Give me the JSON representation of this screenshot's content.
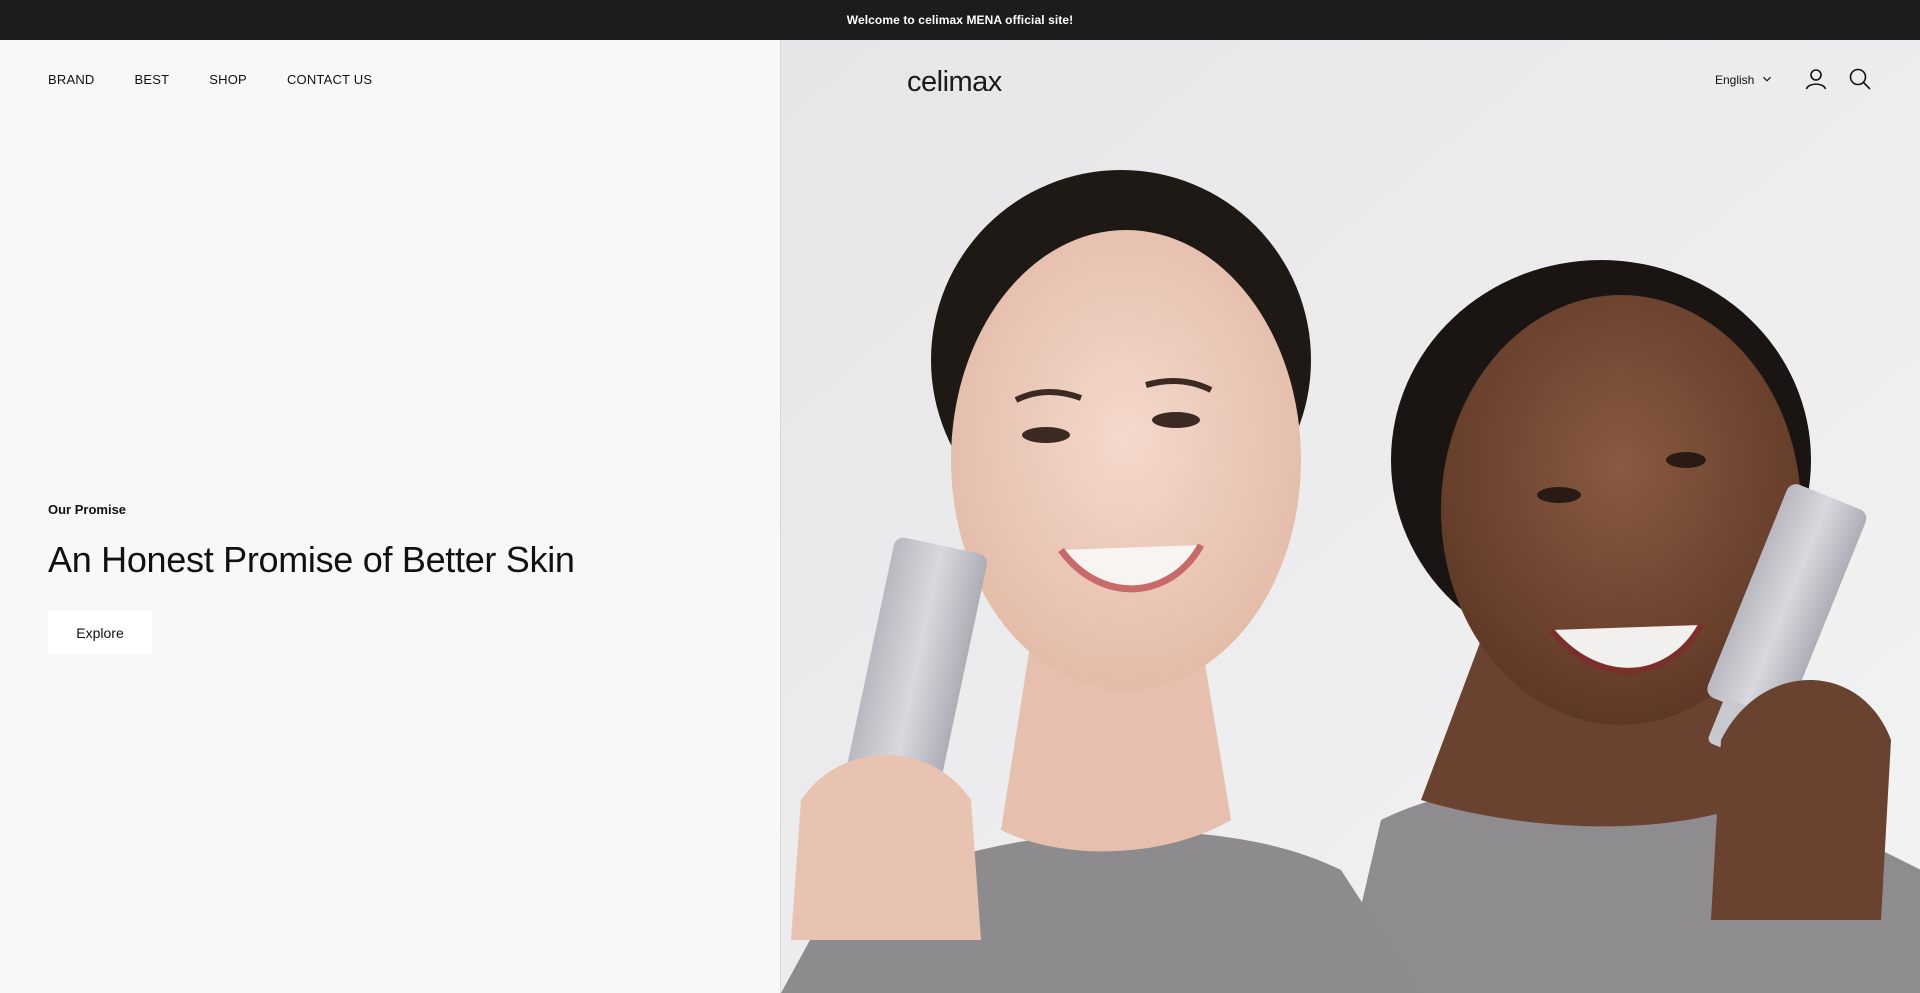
{
  "announcement": {
    "text": "Welcome to celimax MENA official site!"
  },
  "header": {
    "nav": [
      {
        "label": "BRAND"
      },
      {
        "label": "BEST"
      },
      {
        "label": "SHOP"
      },
      {
        "label": "CONTACT US"
      }
    ],
    "logo": "celimax",
    "language": {
      "selected": "English",
      "icon": "chevron-down-icon"
    },
    "icons": {
      "account": "user-icon",
      "search": "search-icon"
    }
  },
  "hero": {
    "eyebrow": "Our Promise",
    "headline": "An Honest Promise of Better Skin",
    "cta_label": "Explore",
    "image": "two-smiling-women-holding-skincare-tubes"
  },
  "colors": {
    "announcement_bg": "#1c1c1c",
    "page_bg": "#f8f8f8",
    "text": "#111111",
    "button_bg": "#ffffff"
  }
}
